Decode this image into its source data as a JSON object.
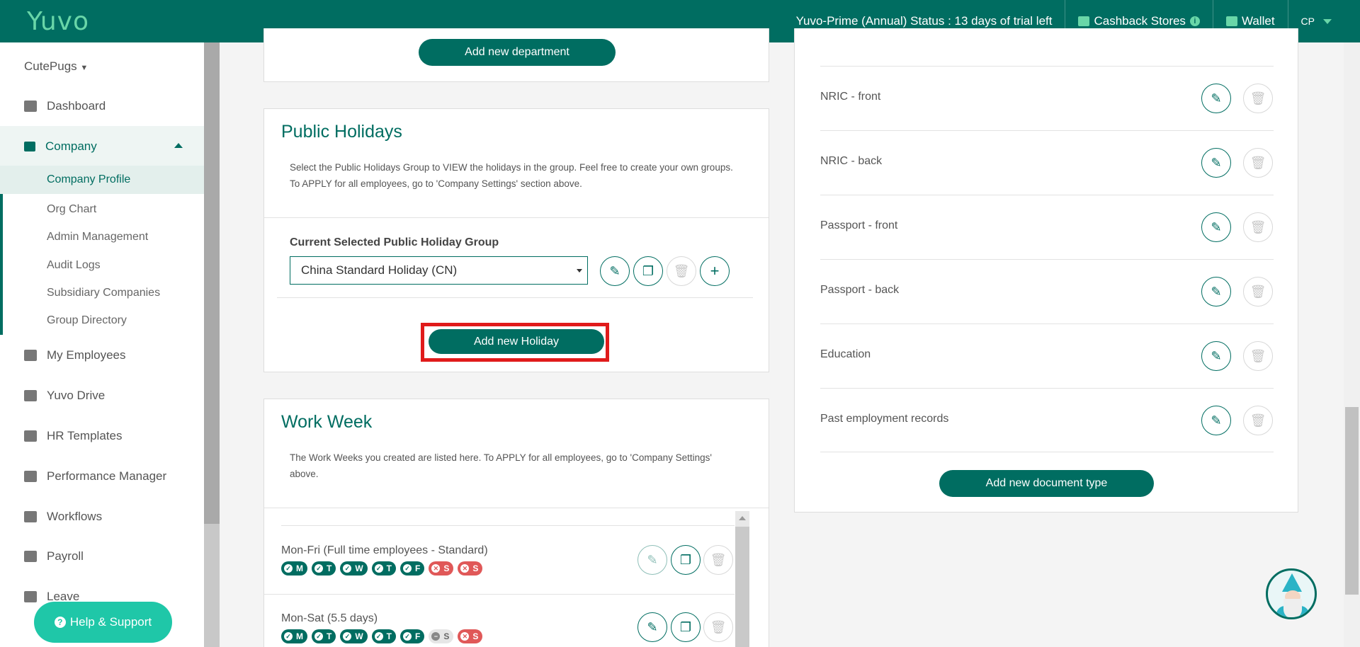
{
  "topbar": {
    "logo": "Yuvo",
    "status": "Yuvo-Prime (Annual) Status : 13 days of trial left",
    "cashback": "Cashback Stores",
    "wallet": "Wallet",
    "user": "CP"
  },
  "sidebar": {
    "brand": "CutePugs",
    "dashboard": "Dashboard",
    "company": "Company",
    "sub": [
      "Company Profile",
      "Org Chart",
      "Admin Management",
      "Audit Logs",
      "Subsidiary Companies",
      "Group Directory"
    ],
    "items": [
      "My Employees",
      "Yuvo Drive",
      "HR Templates",
      "Performance Manager",
      "Workflows",
      "Payroll",
      "Leave"
    ],
    "help": "Help & Support"
  },
  "department": {
    "add_button": "Add new department"
  },
  "holidays": {
    "title": "Public Holidays",
    "description": "Select the Public Holidays Group to VIEW the holidays in the group. Feel free to create your own groups. To APPLY for all employees, go to 'Company Settings' section above.",
    "group_label": "Current Selected Public Holiday Group",
    "selected_group": "China Standard Holiday (CN)",
    "add_button": "Add new Holiday"
  },
  "work_week": {
    "title": "Work Week",
    "description": "The Work Weeks you created are listed here. To APPLY for all employees, go to 'Company Settings' above.",
    "rows": [
      {
        "name": "Mon-Fri (Full time employees - Standard)",
        "days": [
          "M",
          "T",
          "W",
          "T",
          "F",
          "S",
          "S"
        ]
      },
      {
        "name": "Mon-Sat (5.5 days)",
        "days": [
          "M",
          "T",
          "W",
          "T",
          "F",
          "S",
          "S"
        ]
      }
    ]
  },
  "documents": {
    "rows": [
      "NRIC - front",
      "NRIC - back",
      "Passport - front",
      "Passport - back",
      "Education",
      "Past employment records"
    ],
    "add_button": "Add new document type"
  },
  "colors": {
    "primary": "#006d61",
    "accent": "#69d6a8",
    "off": "#e05858",
    "help": "#1fc7a8",
    "highlight": "#e01b1b"
  }
}
